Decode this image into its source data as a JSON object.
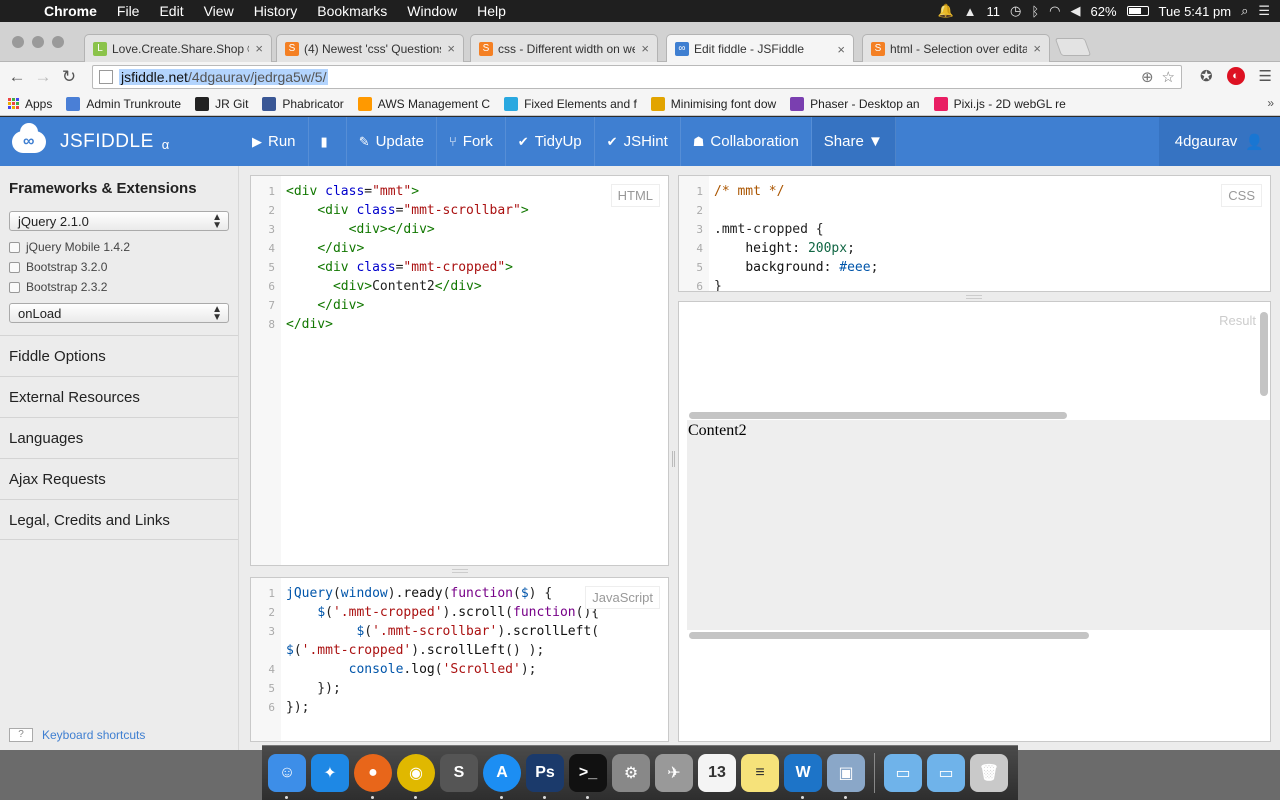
{
  "menubar": {
    "app": "Chrome",
    "items": [
      "File",
      "Edit",
      "View",
      "History",
      "Bookmarks",
      "Window",
      "Help"
    ],
    "notif_count": "11",
    "battery": "62%",
    "clock": "Tue 5:41 pm"
  },
  "tabs": [
    {
      "title": "Love.Create.Share.Shop ©",
      "fav_color": "#8bc34a",
      "fav_letter": "L"
    },
    {
      "title": "(4) Newest 'css' Questions",
      "fav_color": "#f48024",
      "fav_letter": "S"
    },
    {
      "title": "css - Different width on we",
      "fav_color": "#f48024",
      "fav_letter": "S"
    },
    {
      "title": "Edit fiddle - JSFiddle",
      "fav_color": "#3f7fd1",
      "fav_letter": "∞"
    },
    {
      "title": "html - Selection over edital",
      "fav_color": "#f48024",
      "fav_letter": "S"
    }
  ],
  "omnibox": {
    "domain": "jsfiddle.net",
    "path": "/4dgaurav/jedrga5w/5/"
  },
  "bookmarks": [
    {
      "label": "Apps",
      "icon": "apps-icon",
      "color": "#e44"
    },
    {
      "label": "Admin Trunkroute",
      "icon": "folder-icon",
      "color": "#4a7fd6"
    },
    {
      "label": "JR Git",
      "icon": "github-icon",
      "color": "#222"
    },
    {
      "label": "Phabricator",
      "icon": "phabricator-icon",
      "color": "#3a5795"
    },
    {
      "label": "AWS Management C",
      "icon": "aws-icon",
      "color": "#f90"
    },
    {
      "label": "Fixed Elements and f",
      "icon": "k-icon",
      "color": "#29a8e0"
    },
    {
      "label": "Minimising font dow",
      "icon": "j-icon",
      "color": "#e2a400"
    },
    {
      "label": "Phaser - Desktop an",
      "icon": "phaser-icon",
      "color": "#7a3fb0"
    },
    {
      "label": "Pixi.js - 2D webGL re",
      "icon": "pixi-icon",
      "color": "#e91e63"
    }
  ],
  "jsfiddle": {
    "brand": "JSFIDDLE",
    "alpha": "α",
    "actions": [
      {
        "label": "Run",
        "icon": "▶"
      },
      {
        "label": "",
        "icon": "▮"
      },
      {
        "label": "Update",
        "icon": "✎"
      },
      {
        "label": "Fork",
        "icon": "⑂"
      },
      {
        "label": "TidyUp",
        "icon": "✔"
      },
      {
        "label": "JSHint",
        "icon": "✔"
      },
      {
        "label": "Collaboration",
        "icon": "☗"
      },
      {
        "label": "Share ▼",
        "icon": ""
      }
    ],
    "user": "4dgaurav",
    "accent": "#3f7fd1"
  },
  "sidebar": {
    "heading": "Frameworks & Extensions",
    "framework_select": "jQuery 2.1.0",
    "options": [
      "jQuery Mobile 1.4.2",
      "Bootstrap 3.2.0",
      "Bootstrap 2.3.2"
    ],
    "load_select": "onLoad",
    "sections": [
      "Fiddle Options",
      "External Resources",
      "Languages",
      "Ajax Requests",
      "Legal, Credits and Links"
    ],
    "keyboard_key": "?",
    "keyboard_label": "Keyboard shortcuts"
  },
  "panels": {
    "html_label": "HTML",
    "css_label": "CSS",
    "js_label": "JavaScript",
    "result_label": "Result",
    "result_text": "Content2"
  },
  "dock": [
    {
      "name": "finder-icon",
      "color": "#3d8ee8",
      "glyph": "☺"
    },
    {
      "name": "safari-icon",
      "color": "#1e88e5",
      "glyph": "✦"
    },
    {
      "name": "firefox-icon",
      "color": "#e8661a",
      "glyph": "●"
    },
    {
      "name": "chrome-icon",
      "color": "#e0b800",
      "glyph": "◉"
    },
    {
      "name": "sublime-icon",
      "color": "#555",
      "glyph": "S"
    },
    {
      "name": "appstore-icon",
      "color": "#1c8ef3",
      "glyph": "A"
    },
    {
      "name": "photoshop-icon",
      "color": "#1b3a6b",
      "glyph": "Ps"
    },
    {
      "name": "terminal-icon",
      "color": "#111",
      "glyph": ">_"
    },
    {
      "name": "settings-icon",
      "color": "#888",
      "glyph": "⚙"
    },
    {
      "name": "launchpad-icon",
      "color": "#999",
      "glyph": "✈"
    },
    {
      "name": "calendar-icon",
      "color": "#f4f4f4",
      "glyph": "13"
    },
    {
      "name": "notes-icon",
      "color": "#f6e27a",
      "glyph": "≡"
    },
    {
      "name": "word-icon",
      "color": "#1d74c8",
      "glyph": "W"
    },
    {
      "name": "preview-icon",
      "color": "#8aa7c8",
      "glyph": "▣"
    },
    {
      "name": "documents-folder-icon",
      "color": "#6fb3ea",
      "glyph": "▭"
    },
    {
      "name": "downloads-folder-icon",
      "color": "#6fb3ea",
      "glyph": "▭"
    },
    {
      "name": "trash-icon",
      "color": "#c9c9c9",
      "glyph": "🗑"
    }
  ]
}
